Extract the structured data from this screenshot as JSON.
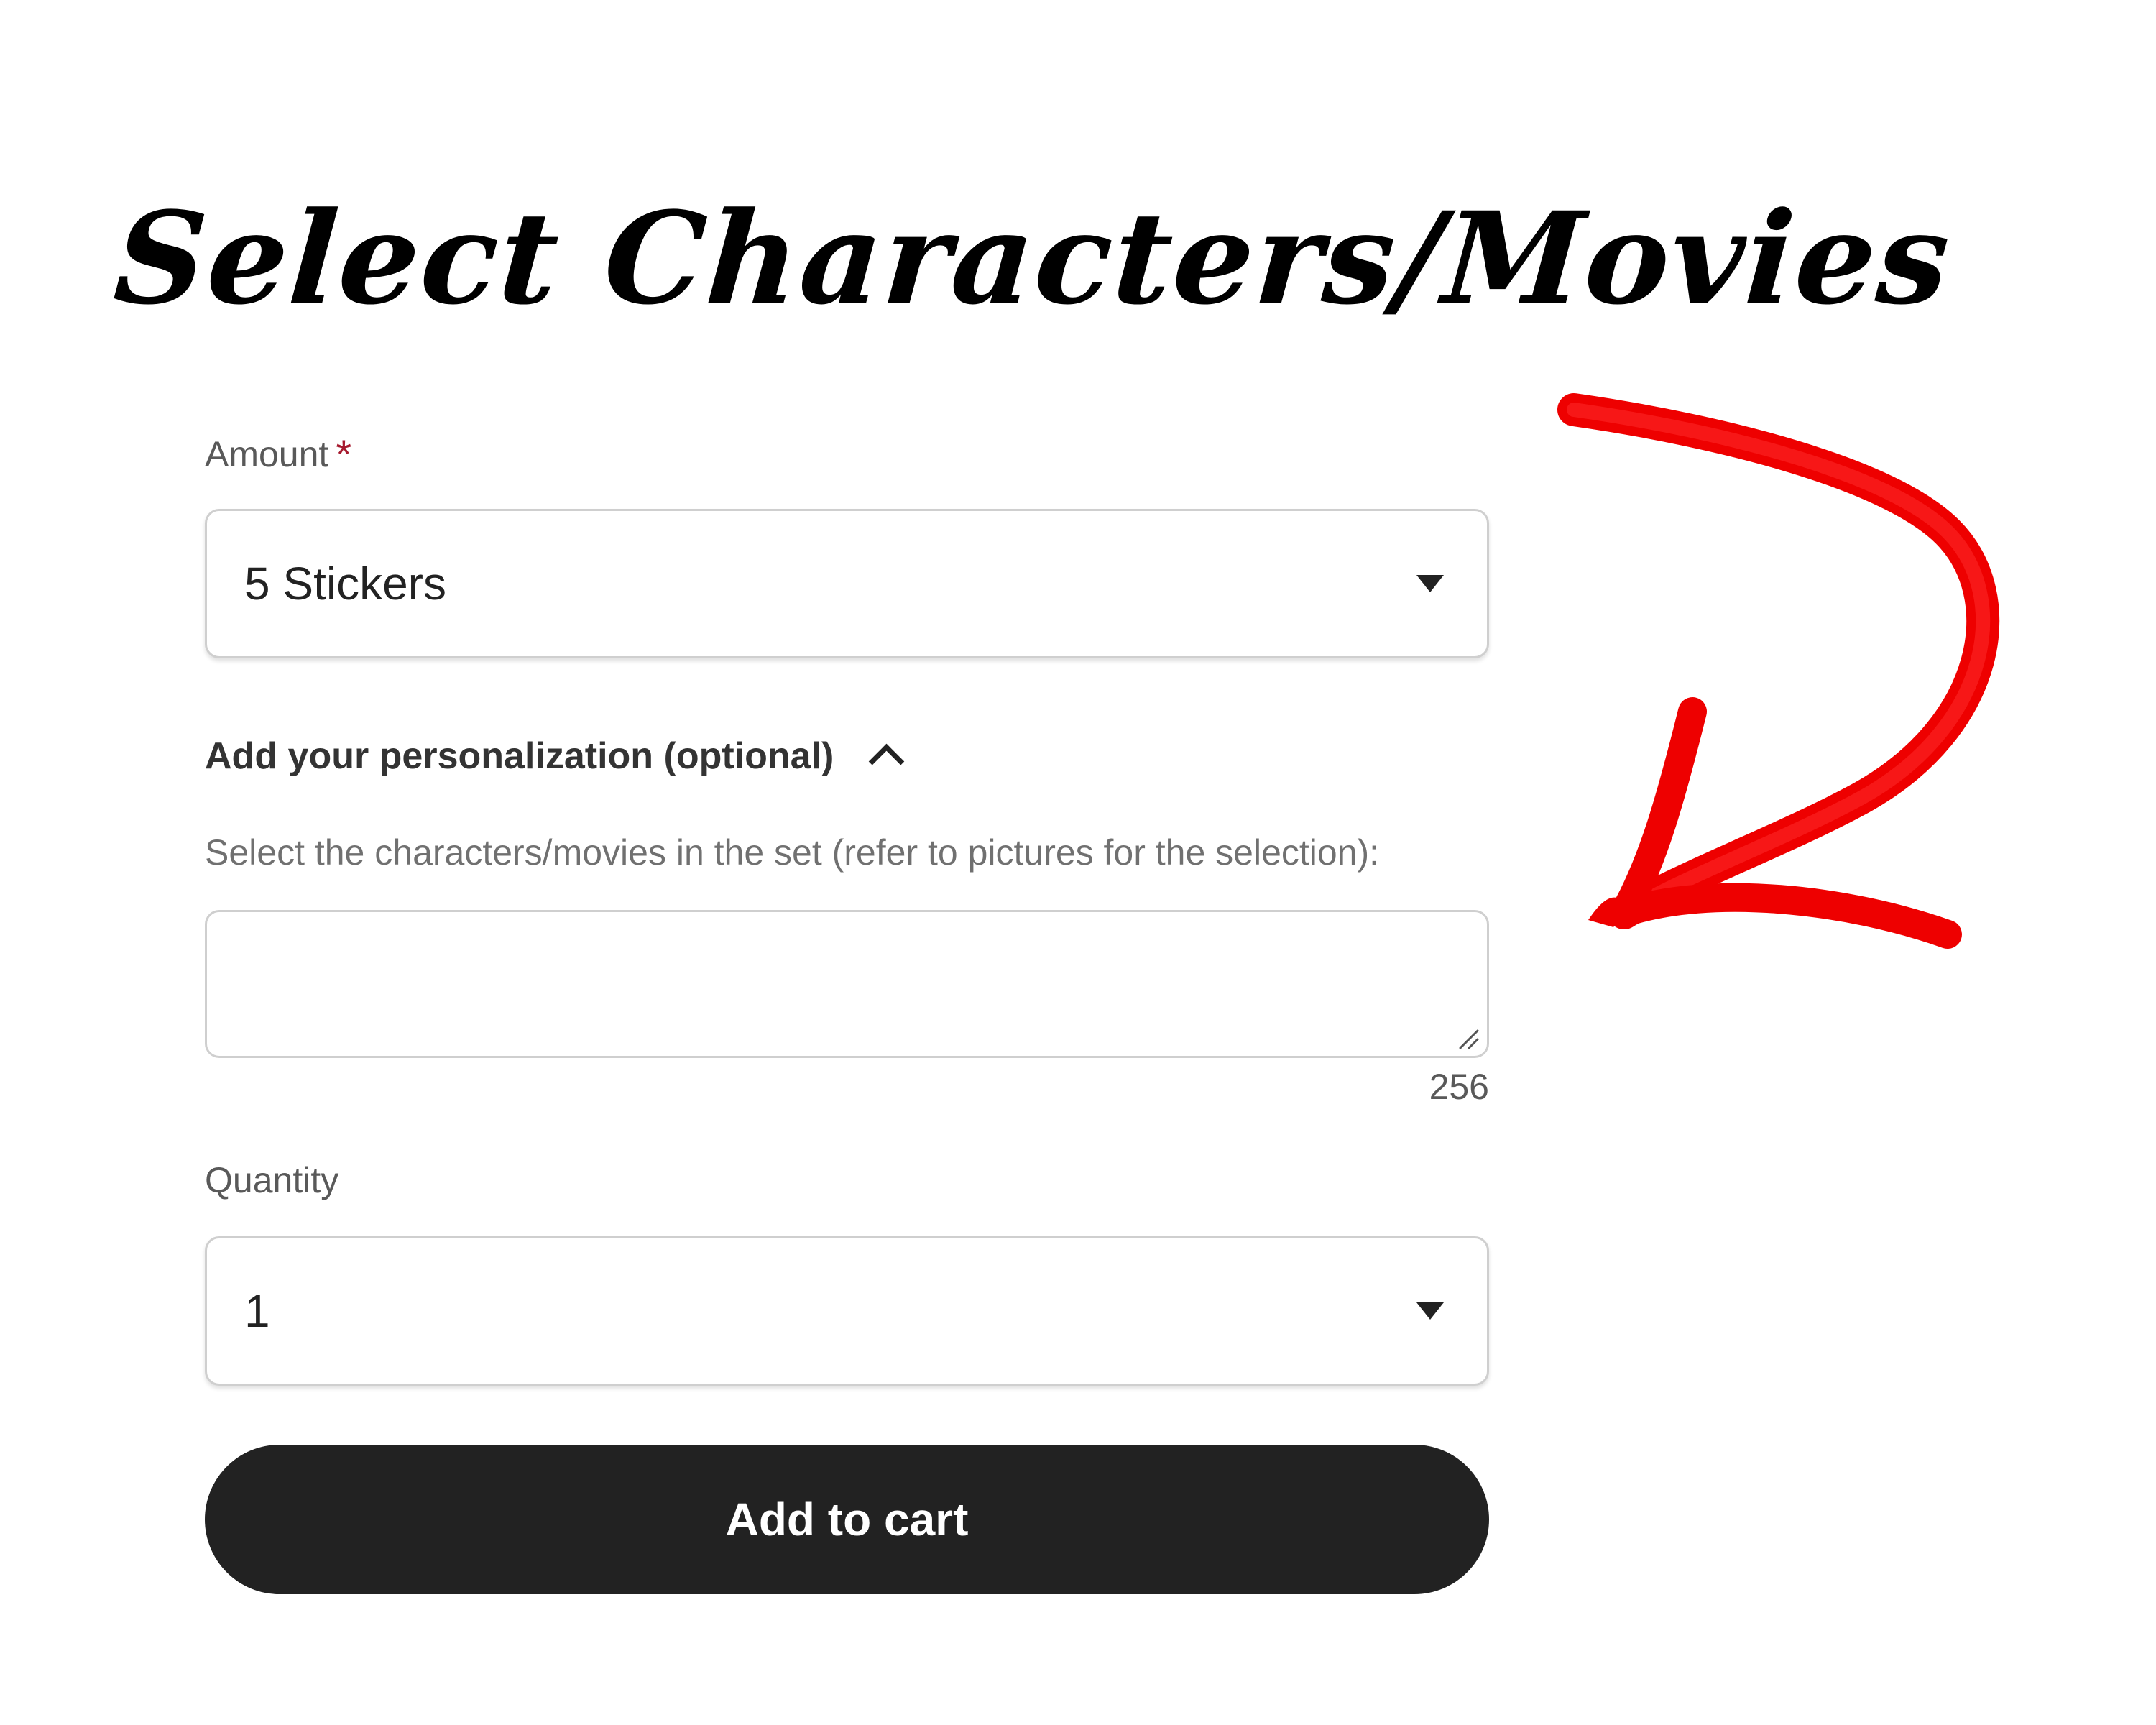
{
  "headline": "Select Characters/Movies",
  "amount": {
    "label": "Amount",
    "required_mark": "*",
    "selected": "5 Stickers"
  },
  "personalization": {
    "toggle_label": "Add your personalization (optional)",
    "expanded": true,
    "instructions": "Select the characters/movies in the set (refer to pictures for the selection):",
    "value": "",
    "remaining_characters": "256"
  },
  "quantity": {
    "label": "Quantity",
    "selected": "1"
  },
  "cart": {
    "button_label": "Add to cart"
  },
  "colors": {
    "arrow": "#ee0000",
    "button_bg": "#222222",
    "required_star": "#a61a2e",
    "border": "#cfcfcf"
  },
  "icons": {
    "select_caret": "caret-down-icon",
    "toggle": "chevron-up-icon",
    "textarea_corner": "resize-handle-icon",
    "annotation": "hand-drawn-arrow-icon"
  }
}
